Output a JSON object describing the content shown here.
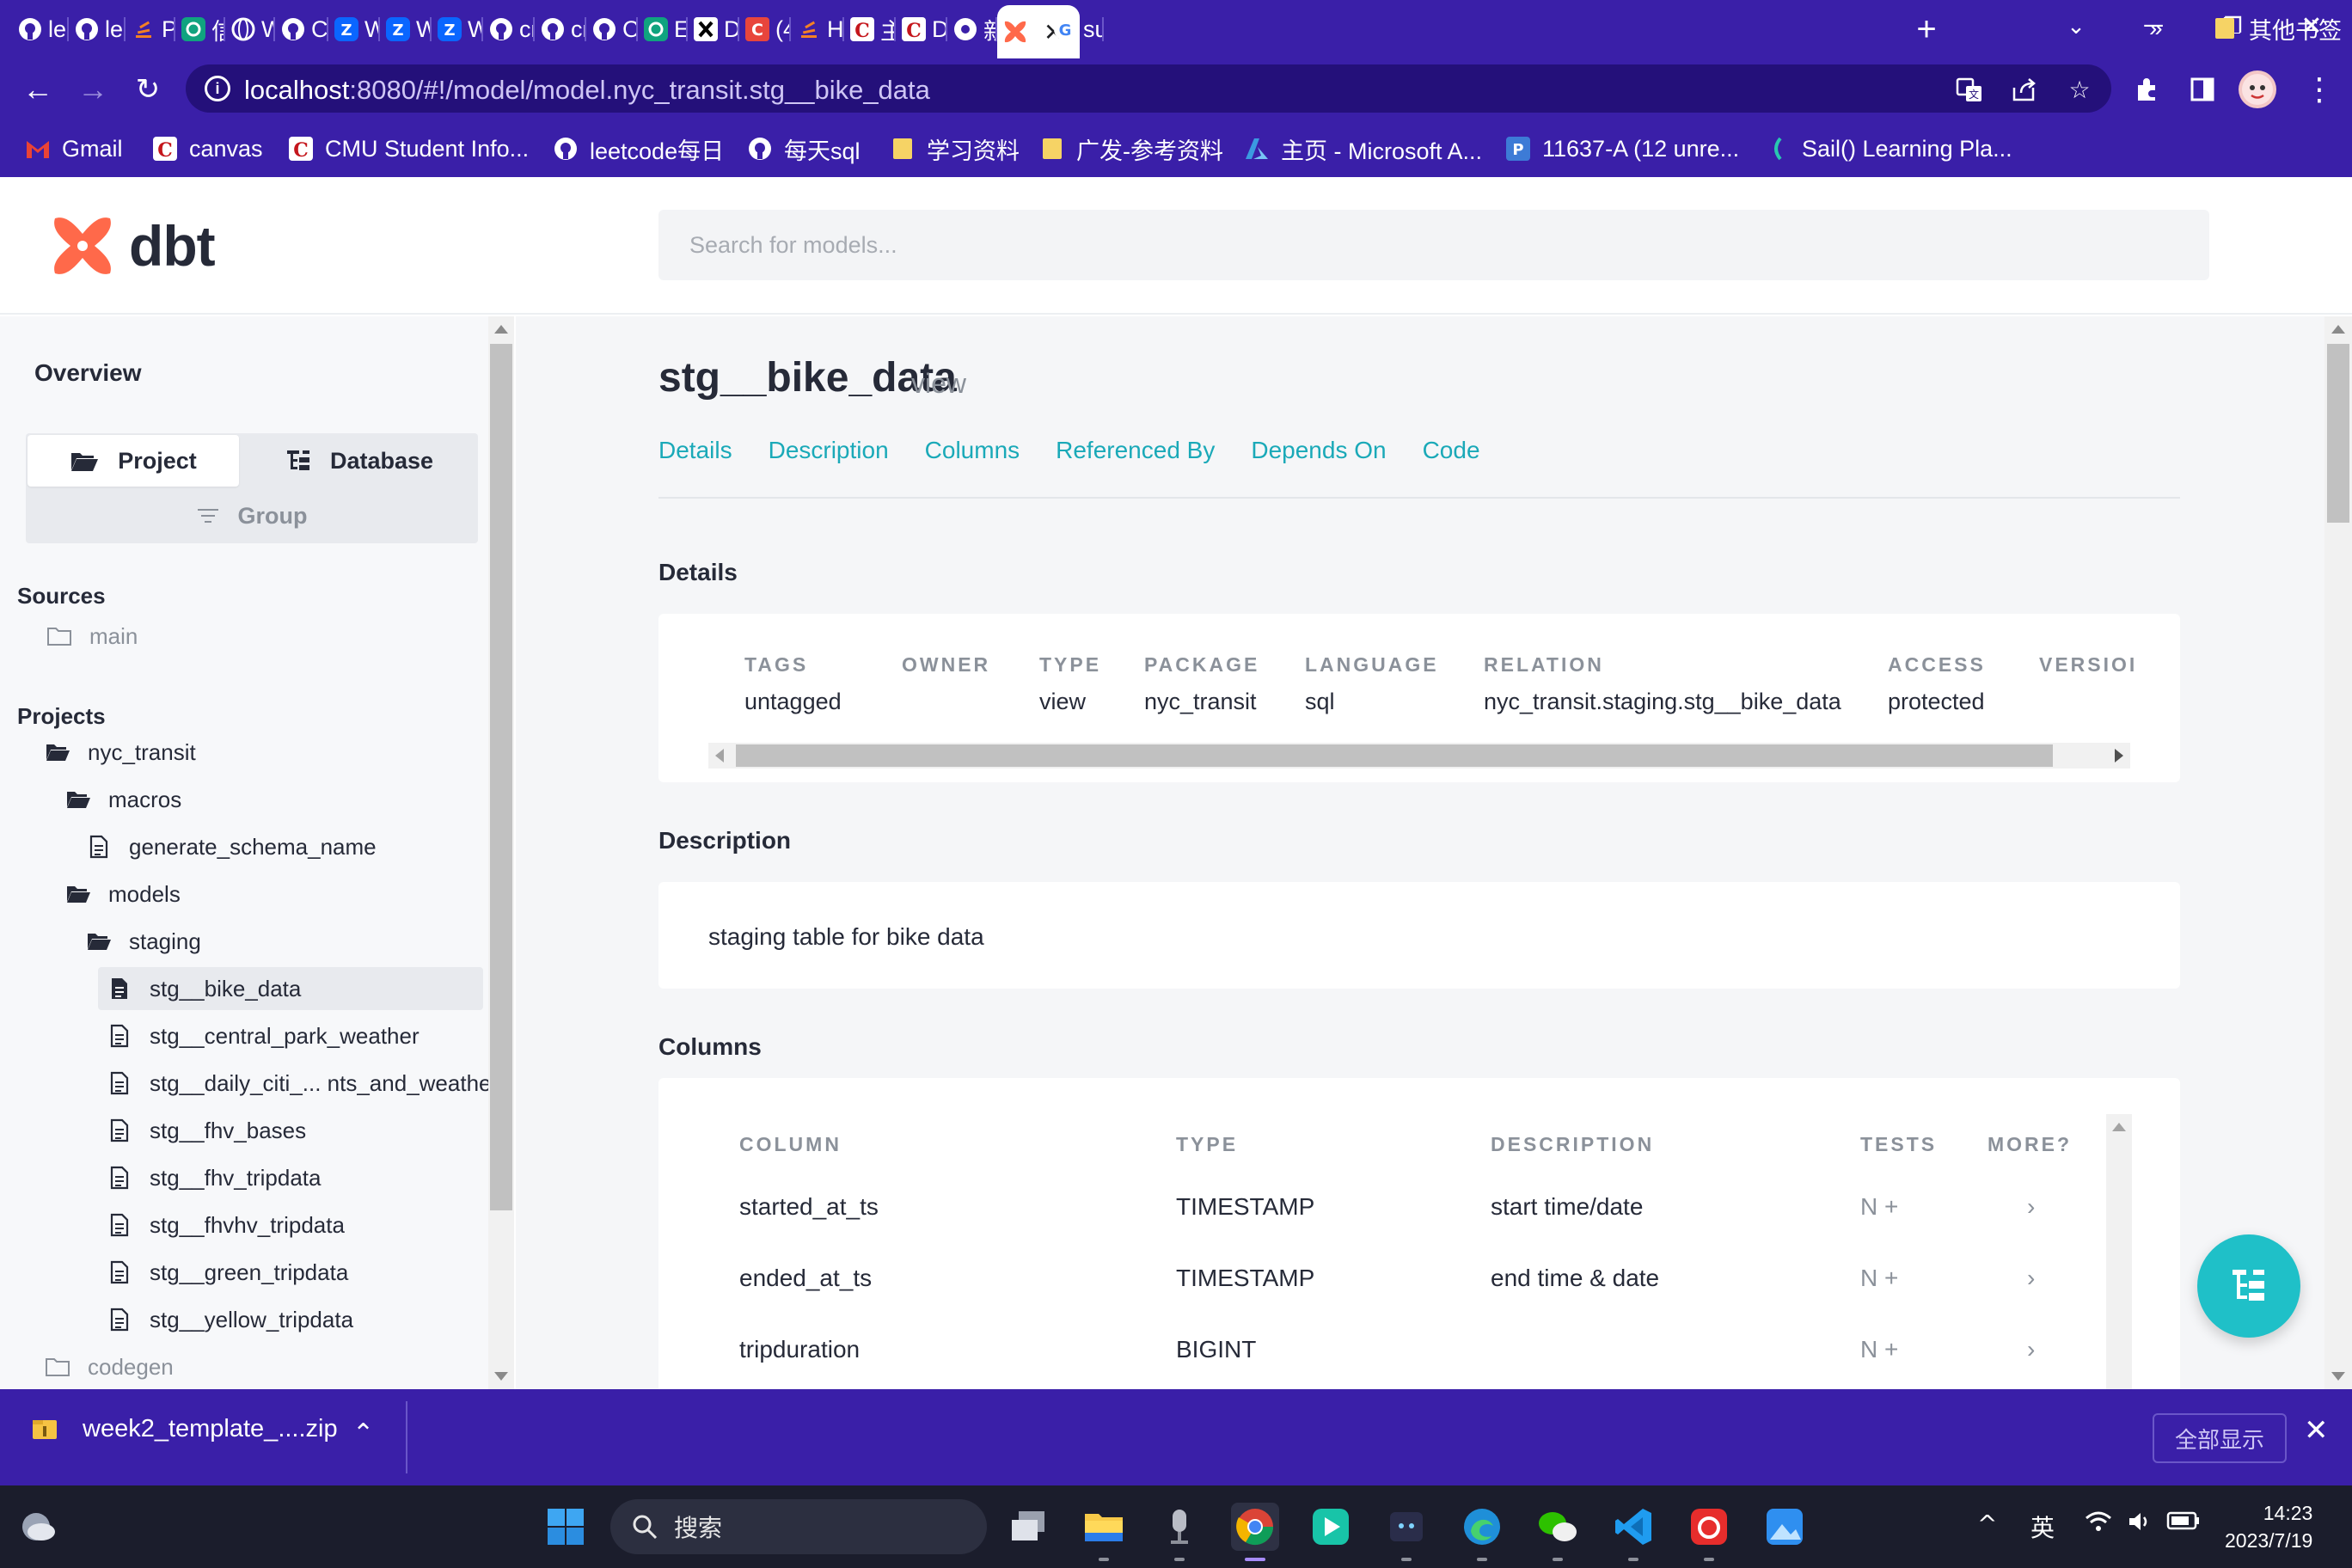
{
  "browser": {
    "tabs": [
      {
        "label": "le",
        "icon": "github-icon",
        "color": "#ffffff"
      },
      {
        "label": "le",
        "icon": "github-icon",
        "color": "#ffffff"
      },
      {
        "label": "Pa",
        "icon": "stackoverflow-icon",
        "color": "#f48024"
      },
      {
        "label": "信",
        "icon": "openai-icon",
        "color": "#10a37f"
      },
      {
        "label": "W",
        "icon": "globe-icon",
        "color": "#ffffff"
      },
      {
        "label": "Cc",
        "icon": "github-icon",
        "color": "#ffffff"
      },
      {
        "label": "W",
        "icon": "zhihu-icon",
        "color": "#0a66ff"
      },
      {
        "label": "W",
        "icon": "zhihu-icon",
        "color": "#0a66ff"
      },
      {
        "label": "W",
        "icon": "zhihu-icon",
        "color": "#0a66ff"
      },
      {
        "label": "cn",
        "icon": "github-icon",
        "color": "#ffffff"
      },
      {
        "label": "cn",
        "icon": "github-icon",
        "color": "#ffffff"
      },
      {
        "label": "Cl",
        "icon": "github-icon",
        "color": "#ffffff"
      },
      {
        "label": "En",
        "icon": "openai-icon",
        "color": "#10a37f"
      },
      {
        "label": "De",
        "icon": "x-icon",
        "color": "#000000"
      },
      {
        "label": "(4",
        "icon": "c-icon",
        "color": "#e8453c"
      },
      {
        "label": "Hc",
        "icon": "stackoverflow-icon",
        "color": "#f48024"
      },
      {
        "label": "主",
        "icon": "canvas-icon",
        "color": "#c4161c"
      },
      {
        "label": "Da",
        "icon": "canvas-icon",
        "color": "#c4161c"
      },
      {
        "label": "新",
        "icon": "chrome-icon",
        "color": "#ffffff"
      },
      {
        "label": "",
        "icon": "dbt-icon",
        "color": "#ff694a",
        "active": true
      },
      {
        "label": "su",
        "icon": "google-icon",
        "color": "#ffffff"
      }
    ],
    "url_host": "localhost",
    "url_path": ":8080/#!/model/model.nyc_transit.stg__bike_data",
    "bookmarks": [
      {
        "label": "Gmail",
        "icon": "gmail-icon",
        "color": "#ea4335"
      },
      {
        "label": "canvas",
        "icon": "canvas-icon",
        "color": "#c4161c"
      },
      {
        "label": "CMU Student Info...",
        "icon": "canvas-icon",
        "color": "#c4161c"
      },
      {
        "label": "leetcode每日",
        "icon": "github-icon",
        "color": "#ffffff"
      },
      {
        "label": "每天sql",
        "icon": "github-icon",
        "color": "#ffffff"
      },
      {
        "label": "学习资料",
        "icon": "folder-icon",
        "color": "#f6d365"
      },
      {
        "label": "广发-参考资料",
        "icon": "folder-icon",
        "color": "#f6d365"
      },
      {
        "label": "主页 - Microsoft A...",
        "icon": "azure-icon",
        "color": "#3b9ae1"
      },
      {
        "label": "11637-A (12 unre...",
        "icon": "piazza-icon",
        "color": "#3d7bd6"
      },
      {
        "label": "Sail() Learning Pla...",
        "icon": "sail-icon",
        "color": "#29c7b0"
      }
    ],
    "bookmarks_overflow": "»",
    "other_bookmarks": "其他书签"
  },
  "app": {
    "logo_text": "dbt",
    "search_placeholder": "Search for models...",
    "brand_color": "#ff694a",
    "accent_color": "#1fc0c8"
  },
  "sidebar": {
    "overview": "Overview",
    "tabs": {
      "project": "Project",
      "database": "Database",
      "group": "Group"
    },
    "sources_label": "Sources",
    "sources": [
      {
        "label": "main"
      }
    ],
    "projects_label": "Projects",
    "tree": [
      {
        "label": "nyc_transit",
        "type": "folder-open",
        "depth": 0
      },
      {
        "label": "macros",
        "type": "folder-open",
        "depth": 1
      },
      {
        "label": "generate_schema_name",
        "type": "file",
        "depth": 2
      },
      {
        "label": "models",
        "type": "folder-open",
        "depth": 1
      },
      {
        "label": "staging",
        "type": "folder-open",
        "depth": 2
      },
      {
        "label": "stg__bike_data",
        "type": "file",
        "depth": 3,
        "selected": true
      },
      {
        "label": "stg__central_park_weather",
        "type": "file",
        "depth": 3
      },
      {
        "label": "stg__daily_citi_... nts_and_weather",
        "type": "file",
        "depth": 3
      },
      {
        "label": "stg__fhv_bases",
        "type": "file",
        "depth": 3
      },
      {
        "label": "stg__fhv_tripdata",
        "type": "file",
        "depth": 3
      },
      {
        "label": "stg__fhvhv_tripdata",
        "type": "file",
        "depth": 3
      },
      {
        "label": "stg__green_tripdata",
        "type": "file",
        "depth": 3
      },
      {
        "label": "stg__yellow_tripdata",
        "type": "file",
        "depth": 3
      },
      {
        "label": "codegen",
        "type": "folder-closed",
        "depth": 0
      }
    ]
  },
  "model": {
    "name": "stg__bike_data",
    "kind": "view",
    "tabs": [
      "Details",
      "Description",
      "Columns",
      "Referenced By",
      "Depends On",
      "Code"
    ],
    "details_title": "Details",
    "details": [
      {
        "key": "TAGS",
        "value": "untagged"
      },
      {
        "key": "OWNER",
        "value": ""
      },
      {
        "key": "TYPE",
        "value": "view"
      },
      {
        "key": "PACKAGE",
        "value": "nyc_transit"
      },
      {
        "key": "LANGUAGE",
        "value": "sql"
      },
      {
        "key": "RELATION",
        "value": "nyc_transit.staging.stg__bike_data"
      },
      {
        "key": "ACCESS",
        "value": "protected"
      },
      {
        "key": "VERSIOI",
        "value": ""
      }
    ],
    "description_title": "Description",
    "description": "staging table for bike data",
    "columns_title": "Columns",
    "column_headers": [
      "COLUMN",
      "TYPE",
      "DESCRIPTION",
      "TESTS",
      "MORE?"
    ],
    "columns": [
      {
        "name": "started_at_ts",
        "type": "TIMESTAMP",
        "description": "start time/date",
        "tests": "N +",
        "more": "›"
      },
      {
        "name": "ended_at_ts",
        "type": "TIMESTAMP",
        "description": "end time & date",
        "tests": "N +",
        "more": "›"
      },
      {
        "name": "tripduration",
        "type": "BIGINT",
        "description": "",
        "tests": "N +",
        "more": "›"
      }
    ]
  },
  "downloads": {
    "file": "week2_template_....zip",
    "show_all": "全部显示"
  },
  "taskbar": {
    "search": "搜索",
    "ime": "英",
    "time": "14:23",
    "date": "2023/7/19"
  }
}
